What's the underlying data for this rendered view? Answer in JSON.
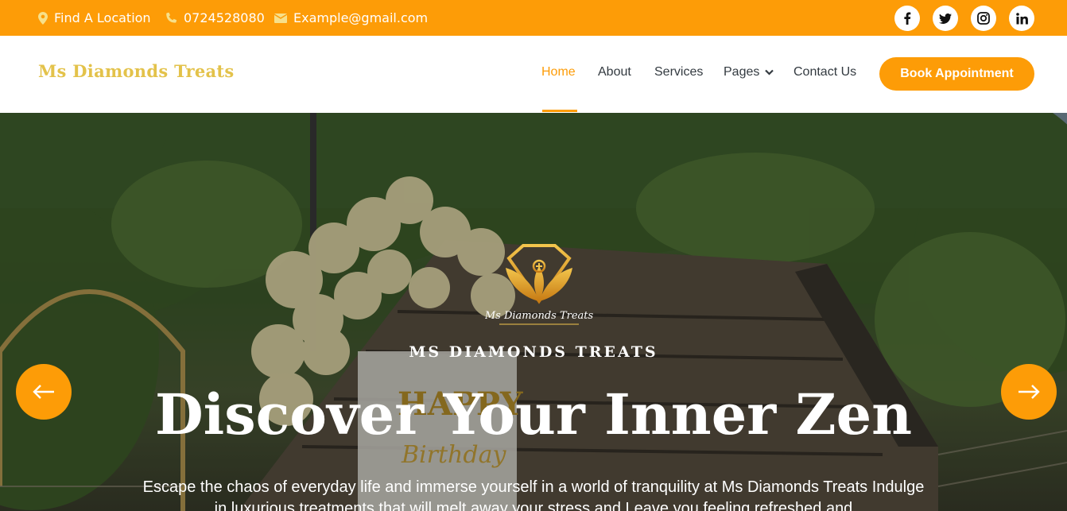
{
  "topbar": {
    "location": "Find A Location",
    "phone": "0724528080",
    "email": "Example@gmail.com",
    "social": [
      {
        "icon": "facebook-icon",
        "glyph": "f"
      },
      {
        "icon": "twitter-icon",
        "glyph": "t"
      },
      {
        "icon": "instagram-icon",
        "glyph": "ig"
      },
      {
        "icon": "linkedin-icon",
        "glyph": "in"
      }
    ]
  },
  "nav": {
    "brand": "Ms Diamonds Treats",
    "links": [
      "Home",
      "About",
      "Services",
      "Pages",
      "Contact Us"
    ],
    "active": "Home",
    "cta": "Book Appointment"
  },
  "hero": {
    "logo_text": "Ms Diamonds Treats",
    "kicker": "MS DIAMONDS TREATS",
    "title": "Discover Your Inner Zen",
    "text": "Escape the chaos of everyday life and immerse yourself in a world of tranquility at Ms Diamonds Treats Indulge in luxurious treatments that will melt away your stress and Leave you feeling refreshed and"
  },
  "colors": {
    "accent": "#fd9c07",
    "brand": "#e3c24a",
    "nav_text": "#333a40"
  }
}
